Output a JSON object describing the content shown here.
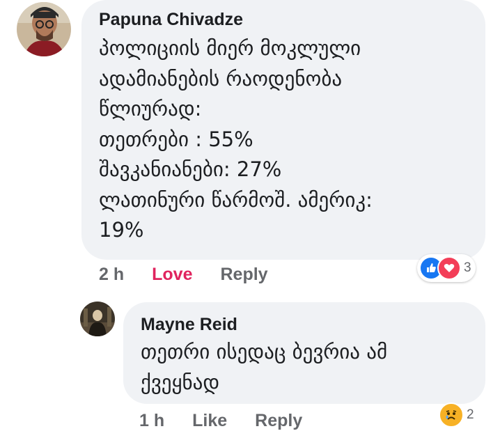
{
  "comments": [
    {
      "author": "Papuna Chivadze",
      "text": "პოლიციის მიერ მოკლული\nადამიანების რაოდენობა\nწლიურად:\nთეთრები : 55%\nშავკანიანები: 27%\nლათინური წარმოშ. ამერიკ:\n19%",
      "time": "2 h",
      "action_reaction": "Love",
      "action_reply": "Reply",
      "reaction_icons": [
        "like-icon",
        "love-icon"
      ],
      "reaction_count": "3"
    },
    {
      "author": "Mayne Reid",
      "text": "თეთრი ისედაც ბევრია ამ\nქვეყნად",
      "time": "1 h",
      "action_reaction": "Like",
      "action_reply": "Reply",
      "reaction_icons": [
        "sad-icon"
      ],
      "reaction_count": "2"
    }
  ],
  "colors": {
    "bubble": "#f0f2f5",
    "love_text": "#e0245e",
    "like_blue": "#1877f2",
    "love_red": "#f33e58",
    "sad_yellow": "#f7b125"
  }
}
